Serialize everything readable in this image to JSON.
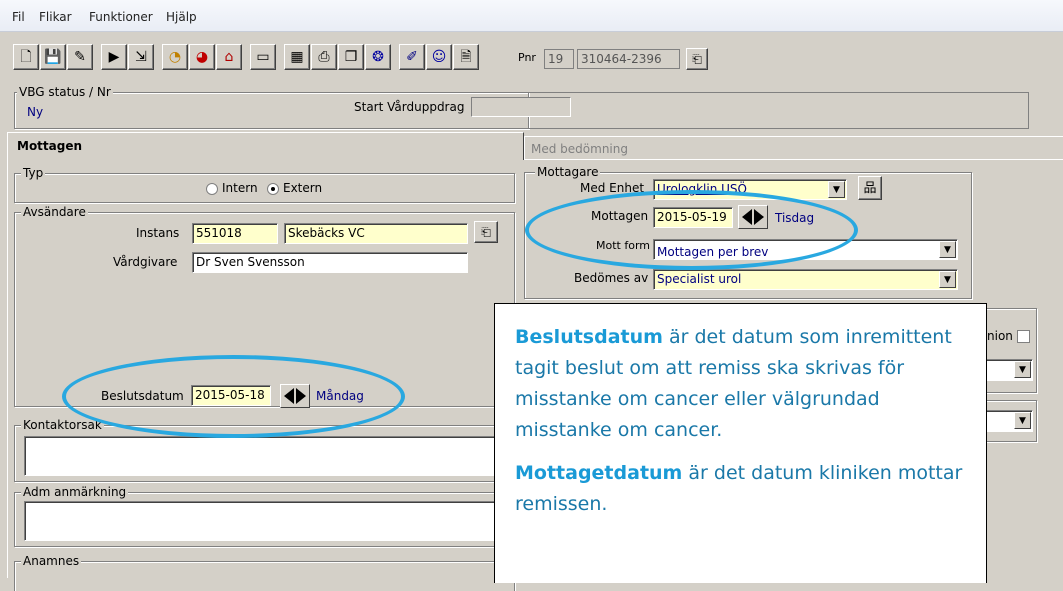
{
  "menu": [
    "Fil",
    "Flikar",
    "Funktioner",
    "Hjälp"
  ],
  "toolbar": {
    "pnr_label": "Pnr",
    "pnr_century": "19",
    "pnr_value": "310464-2396"
  },
  "status": {
    "group_title": "VBG status / Nr",
    "value": "Ny",
    "start_label": "Start Vårduppdrag",
    "start_value": ""
  },
  "tabs": {
    "active": "Mottagen",
    "inactive": "Med bedömning"
  },
  "typ": {
    "title": "Typ",
    "option_intern": "Intern",
    "option_extern": "Extern",
    "selected": "Extern"
  },
  "avsandare": {
    "title": "Avsändare",
    "instans_label": "Instans",
    "instans_code": "551018",
    "instans_name": "Skebäcks VC",
    "vardgivare_label": "Vårdgivare",
    "vardgivare_value": "Dr Sven Svensson",
    "beslutsdatum_label": "Beslutsdatum",
    "beslutsdatum_value": "2015-05-18",
    "beslutsdatum_day": "Måndag"
  },
  "kontaktorsak": {
    "title": "Kontaktorsak"
  },
  "adm": {
    "title": "Adm anmärkning"
  },
  "anamnes": {
    "title": "Anamnes"
  },
  "mottagare": {
    "title": "Mottagare",
    "med_enhet_label": "Med Enhet",
    "med_enhet_value": "Urologklin USÖ",
    "mottagen_label": "Mottagen",
    "mottagen_value": "2015-05-19",
    "mottagen_day": "Tisdag",
    "mott_form_label": "Mott form",
    "mott_form_value": "Mottagen per brev",
    "bedomes_label": "Bedömes av",
    "bedomes_value": "Specialist urol"
  },
  "partial_right": {
    "label_fragment": "nion"
  },
  "callout": {
    "p1_bold": "Beslutsdatum",
    "p1_text": " är det datum som inremittent tagit beslut om att remiss ska skrivas för misstanke om cancer eller välgrundad misstanke om cancer.",
    "p2_bold": "Mottagetdatum",
    "p2_text": " är det datum kliniken mottar remissen."
  },
  "colors": {
    "highlight_ring": "#29a8e0",
    "callout_text": "#1a78a8",
    "field_yellow": "#ffffcc",
    "day_text": "#000080"
  },
  "icons": [
    "new-document-icon",
    "save-icon",
    "edit-icon",
    "forward-icon",
    "export-icon",
    "clock-icon",
    "timer-icon",
    "alarm-icon",
    "card-icon",
    "calendar-icon",
    "print-icon",
    "copy-icon",
    "network-icon",
    "notes-icon",
    "face-icon",
    "document-lock-icon",
    "lookup-icon",
    "org-chart-icon"
  ]
}
